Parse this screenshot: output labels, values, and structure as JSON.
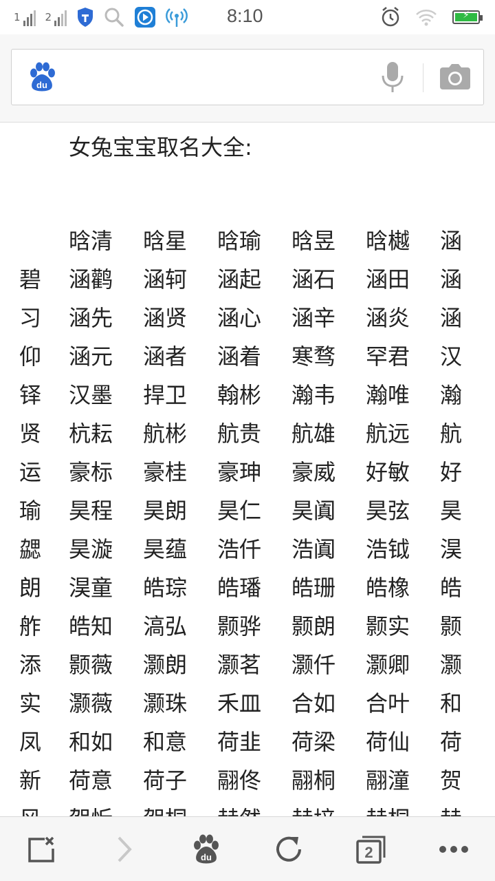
{
  "status_bar": {
    "sim1": "1",
    "sim2": "2",
    "time": "8:10"
  },
  "search": {
    "placeholder": "",
    "logo_text": "du"
  },
  "content": {
    "title": "女兔宝宝取名大全:",
    "rows": [
      [
        "",
        "晗清",
        "晗星",
        "晗瑜",
        "晗昱",
        "晗樾",
        "涵"
      ],
      [
        "碧",
        "涵鹳",
        "涵轲",
        "涵起",
        "涵石",
        "涵田",
        "涵"
      ],
      [
        "习",
        "涵先",
        "涵贤",
        "涵心",
        "涵辛",
        "涵炎",
        "涵"
      ],
      [
        "仰",
        "涵元",
        "涵者",
        "涵着",
        "寒骛",
        "罕君",
        "汉"
      ],
      [
        "铎",
        "汉墨",
        "捍卫",
        "翰彬",
        "瀚韦",
        "瀚唯",
        "瀚"
      ],
      [
        "贤",
        "杭耘",
        "航彬",
        "航贵",
        "航雄",
        "航远",
        "航"
      ],
      [
        "运",
        "豪标",
        "豪桂",
        "豪珅",
        "豪威",
        "好敏",
        "好"
      ],
      [
        "瑜",
        "昊程",
        "昊朗",
        "昊仁",
        "昊阗",
        "昊弦",
        "昊"
      ],
      [
        "勰",
        "昊漩",
        "昊蕴",
        "浩仟",
        "浩阗",
        "浩钺",
        "淏"
      ],
      [
        "朗",
        "淏童",
        "皓琮",
        "皓璠",
        "皓珊",
        "皓橡",
        "皓"
      ],
      [
        "舴",
        "皓知",
        "滈弘",
        "颢骅",
        "颢朗",
        "颢实",
        "颢"
      ],
      [
        "添",
        "颢薇",
        "灏朗",
        "灏茗",
        "灏仟",
        "灏卿",
        "灏"
      ],
      [
        "实",
        "灏薇",
        "灏珠",
        "禾皿",
        "合如",
        "合叶",
        "和"
      ],
      [
        "凤",
        "和如",
        "和意",
        "荷韭",
        "荷梁",
        "荷仙",
        "荷"
      ],
      [
        "新",
        "荷意",
        "荷子",
        "翮佟",
        "翮桐",
        "翮潼",
        "贺"
      ],
      [
        "风",
        "贺忻",
        "贺桐",
        "赫然",
        "赫培",
        "赫桐",
        "赫"
      ]
    ]
  },
  "bottom_nav": {
    "tab_count": "2"
  },
  "colors": {
    "baidu_blue": "#2e6bd4",
    "icon_gray": "#666666",
    "battery_green": "#2fba43"
  }
}
